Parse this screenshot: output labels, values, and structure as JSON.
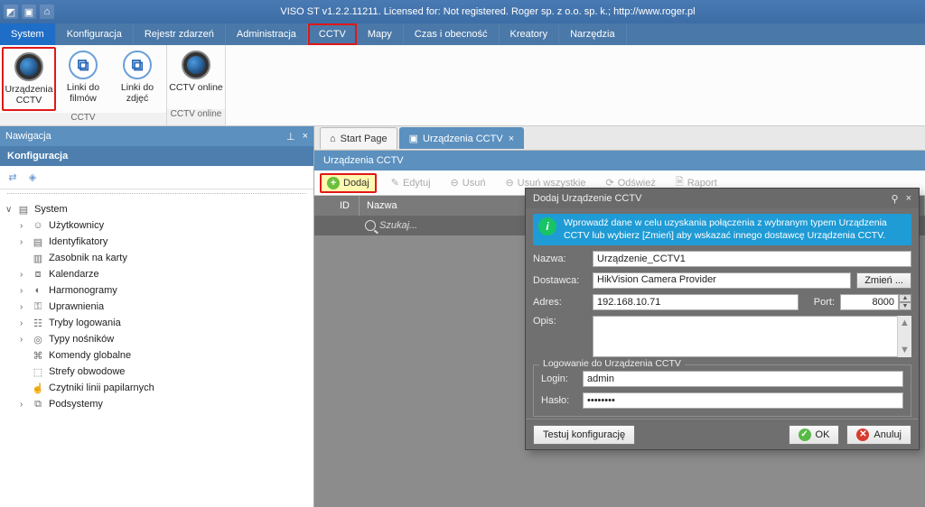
{
  "titlebar": {
    "text": "VISO ST v1.2.2.11211. Licensed for: Not registered. Roger sp. z o.o. sp. k.; http://www.roger.pl"
  },
  "menus": {
    "items": [
      {
        "label": "System",
        "active": true,
        "highlighted": false
      },
      {
        "label": "Konfiguracja",
        "active": false,
        "highlighted": false
      },
      {
        "label": "Rejestr zdarzeń",
        "active": false,
        "highlighted": false
      },
      {
        "label": "Administracja",
        "active": false,
        "highlighted": false
      },
      {
        "label": "CCTV",
        "active": false,
        "highlighted": true
      },
      {
        "label": "Mapy",
        "active": false,
        "highlighted": false
      },
      {
        "label": "Czas i obecność",
        "active": false,
        "highlighted": false
      },
      {
        "label": "Kreatory",
        "active": false,
        "highlighted": false
      },
      {
        "label": "Narzędzia",
        "active": false,
        "highlighted": false
      }
    ]
  },
  "ribbon": {
    "group1": {
      "title": "CCTV",
      "btn1": "Urządzenia CCTV",
      "btn2": "Linki do filmów",
      "btn3": "Linki do zdjęć"
    },
    "group2": {
      "title": "CCTV online",
      "btn1": "CCTV online"
    }
  },
  "nav": {
    "panel_title": "Nawigacja",
    "section": "Konfiguracja",
    "pin_glyph": "⊥",
    "close_glyph": "×",
    "refresh_glyph": "⇄",
    "layers_glyph": "◈",
    "tree": {
      "root": {
        "caret": "∨",
        "label": "System"
      },
      "items": [
        {
          "label": "Użytkownicy"
        },
        {
          "label": "Identyfikatory"
        },
        {
          "label": "Zasobnik na karty"
        },
        {
          "label": "Kalendarze"
        },
        {
          "label": "Harmonogramy"
        },
        {
          "label": "Uprawnienia"
        },
        {
          "label": "Tryby logowania"
        },
        {
          "label": "Typy nośników"
        },
        {
          "label": "Komendy globalne"
        },
        {
          "label": "Strefy obwodowe"
        },
        {
          "label": "Czytniki linii papilarnych"
        },
        {
          "label": "Podsystemy"
        }
      ]
    }
  },
  "tabs": {
    "t1": {
      "label": "Start Page",
      "icon": "⌂"
    },
    "t2": {
      "label": "Urządzenia CCTV",
      "icon": "▣",
      "close": "×"
    }
  },
  "doc": {
    "subtitle": "Urządzenia CCTV",
    "toolbar": {
      "add": "Dodaj",
      "edit": "Edytuj",
      "del": "Usuń",
      "del_all": "Usuń wszystkie",
      "refresh": "Odśwież",
      "report": "Raport"
    },
    "grid": {
      "col_id": "ID",
      "col_name": "Nazwa",
      "search_ph": "Szukaj..."
    }
  },
  "dialog": {
    "title": "Dodaj Urządzenie CCTV",
    "pin_glyph": "⚲",
    "close_glyph": "×",
    "info_char": "i",
    "info": "Wprowadź dane w celu uzyskania połączenia z wybranym typem Urządzenia CCTV lub wybierz [Zmień] aby wskazać innego dostawcę Urządzenia CCTV.",
    "lbl_name": "Nazwa:",
    "val_name": "Urządzenie_CCTV1",
    "lbl_provider": "Dostawca:",
    "val_provider": "HikVision Camera Provider",
    "btn_change": "Zmień ...",
    "lbl_addr": "Adres:",
    "val_addr": "192.168.10.71",
    "lbl_port": "Port:",
    "val_port": "8000",
    "lbl_desc": "Opis:",
    "scroll_up": "▲",
    "scroll_down": "▼",
    "group_login": "Logowanie do Urządzenia CCTV",
    "lbl_login": "Login:",
    "val_login": "admin",
    "lbl_pass": "Hasło:",
    "val_pass": "••••••••",
    "btn_test": "Testuj konfigurację",
    "btn_ok_glyph": "✓",
    "btn_ok": "OK",
    "btn_cancel_glyph": "✕",
    "btn_cancel": "Anuluj"
  }
}
